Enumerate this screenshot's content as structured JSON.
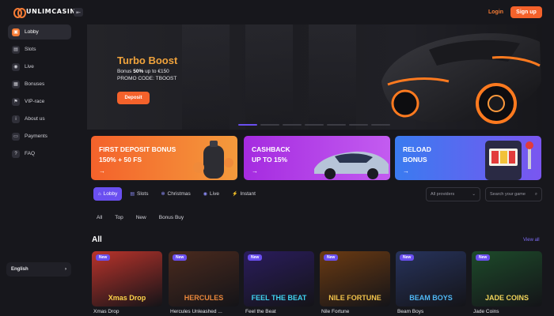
{
  "header": {
    "logo_text": "UNLIMCASINO",
    "collapse_icon": "sidebar-collapse-icon",
    "login_label": "Login",
    "signup_label": "Sign up",
    "accent": "#f4622b"
  },
  "sidebar": {
    "items": [
      {
        "label": "Lobby",
        "icon": "lobby-icon",
        "active": true
      },
      {
        "label": "Slots",
        "icon": "slots-icon"
      },
      {
        "label": "Live",
        "icon": "live-icon"
      },
      {
        "label": "Bonuses",
        "icon": "bonus-icon"
      },
      {
        "label": "VIP-race",
        "icon": "vip-icon"
      },
      {
        "label": "About us",
        "icon": "info-icon"
      },
      {
        "label": "Payments",
        "icon": "payments-icon"
      },
      {
        "label": "FAQ",
        "icon": "faq-icon"
      }
    ],
    "language": "English"
  },
  "hero": {
    "title": "Turbo Boost",
    "line1_prefix": "Bonus ",
    "line1_bold": "50%",
    "line1_suffix": " up to €150",
    "line2": "PROMO CODE: TBOOST",
    "deposit_label": "Deposit",
    "slides": 7,
    "active_slide": 1
  },
  "promos": [
    {
      "line1": "FIRST DEPOSIT BONUS",
      "line2": "150% + 50 FS"
    },
    {
      "line1": "CASHBACK",
      "line2": "UP TO 15%"
    },
    {
      "line1": "RELOAD",
      "line2": "BONUS"
    }
  ],
  "category_tabs": [
    {
      "label": "Lobby",
      "icon": "lobby-icon",
      "active": true
    },
    {
      "label": "Slots",
      "icon": "slots-icon"
    },
    {
      "label": "Christmas",
      "icon": "snowflake-icon"
    },
    {
      "label": "Live",
      "icon": "live-icon"
    },
    {
      "label": "Instant",
      "icon": "instant-icon"
    }
  ],
  "providers_select": "All providers",
  "search_placeholder": "Search your game",
  "sub_tabs": [
    "All",
    "Top",
    "New",
    "Bonus Buy"
  ],
  "section": {
    "title": "All",
    "view_all": "View all"
  },
  "games": [
    {
      "name": "Xmas Drop",
      "art": "Xmas Drop",
      "badge": "New",
      "bg": "#b9332b",
      "fg": "#ffd34a"
    },
    {
      "name": "Hercules Unleashed ...",
      "art": "HERCULES",
      "badge": "New",
      "bg": "#4a2a1e",
      "fg": "#e9873b"
    },
    {
      "name": "Feel the Beat",
      "art": "FEEL THE BEAT",
      "badge": "New",
      "bg": "#2a1c5c",
      "fg": "#3fd2f0"
    },
    {
      "name": "Nile Fortune",
      "art": "NILE FORTUNE",
      "badge": "New",
      "bg": "#6a3a12",
      "fg": "#f1c24a"
    },
    {
      "name": "Beam Boys",
      "art": "BEAM BOYS",
      "badge": "New",
      "bg": "#27335c",
      "fg": "#4fb7f5"
    },
    {
      "name": "Jade Coins",
      "art": "JADE COINS",
      "badge": "New",
      "bg": "#1d4a2a",
      "fg": "#f2d65a"
    }
  ]
}
